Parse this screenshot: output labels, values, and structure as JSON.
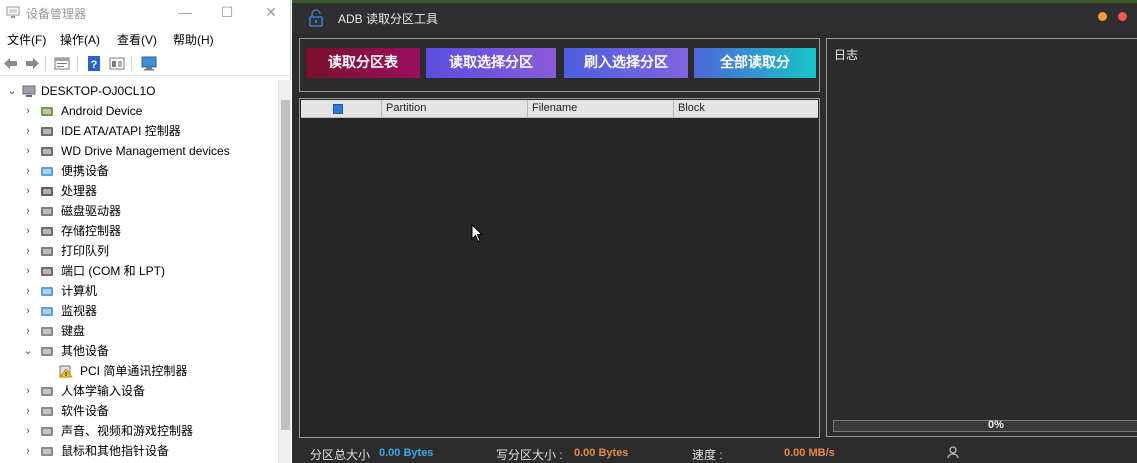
{
  "device_manager": {
    "title": "设备管理器",
    "window_controls": {
      "minimize": "—",
      "maximize": "☐",
      "close": "✕"
    },
    "menu": [
      "文件(F)",
      "操作(A)",
      "查看(V)",
      "帮助(H)"
    ],
    "toolbar_icons": [
      "back-arrow-icon",
      "forward-arrow-icon",
      "properties-icon",
      "help-icon",
      "view-icon",
      "monitor-scan-icon"
    ],
    "tree": {
      "root": "DESKTOP-OJ0CL1O",
      "items": [
        {
          "label": "Android Device",
          "icon": "android-device-icon",
          "expanded": false
        },
        {
          "label": "IDE ATA/ATAPI 控制器",
          "icon": "ide-controller-icon",
          "expanded": false
        },
        {
          "label": "WD Drive Management devices",
          "icon": "wd-device-icon",
          "expanded": false
        },
        {
          "label": "便携设备",
          "icon": "portable-device-icon",
          "expanded": false
        },
        {
          "label": "处理器",
          "icon": "processor-icon",
          "expanded": false
        },
        {
          "label": "磁盘驱动器",
          "icon": "disk-drive-icon",
          "expanded": false
        },
        {
          "label": "存储控制器",
          "icon": "storage-controller-icon",
          "expanded": false
        },
        {
          "label": "打印队列",
          "icon": "printer-icon",
          "expanded": false
        },
        {
          "label": "端口 (COM 和 LPT)",
          "icon": "port-icon",
          "expanded": false
        },
        {
          "label": "计算机",
          "icon": "computer-icon",
          "expanded": false
        },
        {
          "label": "监视器",
          "icon": "monitor-icon",
          "expanded": false
        },
        {
          "label": "键盘",
          "icon": "keyboard-icon",
          "expanded": false
        },
        {
          "label": "其他设备",
          "icon": "other-devices-icon",
          "expanded": true
        },
        {
          "label": "PCI 简单通讯控制器",
          "icon": "warning-device-icon",
          "child": true
        },
        {
          "label": "人体学输入设备",
          "icon": "hid-icon",
          "expanded": false
        },
        {
          "label": "软件设备",
          "icon": "software-device-icon",
          "expanded": false
        },
        {
          "label": "声音、视频和游戏控制器",
          "icon": "sound-icon",
          "expanded": false
        },
        {
          "label": "鼠标和其他指针设备",
          "icon": "mouse-icon",
          "expanded": false
        }
      ]
    }
  },
  "adb_tool": {
    "title": "ADB 读取分区工具",
    "buttons": {
      "read_table": "读取分区表",
      "read_selected": "读取选择分区",
      "flash_selected": "刷入选择分区",
      "read_all": "全部读取分"
    },
    "table": {
      "columns": [
        "Partition",
        "Filename",
        "Block"
      ],
      "rows": []
    },
    "log": {
      "title": "日志",
      "progress_text": "0%",
      "progress_value": 0
    },
    "status": {
      "partition_total_label": "分区总大小",
      "partition_total_value": "0.00 Bytes",
      "write_partition_label": "写分区大小 :",
      "write_partition_value": "0.00 Bytes",
      "speed_label": "速度 :",
      "speed_value": "0.00 MB/s"
    },
    "colors": {
      "accent_blue": "#3aa8e8",
      "accent_orange": "#e8884a",
      "window_bg": "#2c2c2c"
    }
  }
}
